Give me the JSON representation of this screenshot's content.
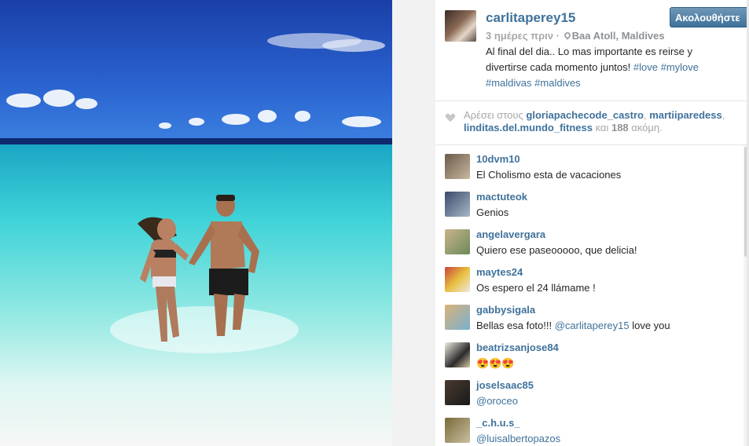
{
  "post": {
    "username": "carlitaperey15",
    "follow_label": "Ακολουθήστε",
    "time": "3 ημέρες πριν",
    "separator": "·",
    "location": "Baa Atoll, Maldives",
    "caption_text": "Al final del dia.. Lo mas importante es reirse y divertirse cada momento juntos!",
    "hashtags": [
      "#love",
      "#mylove",
      "#maldivas",
      "#maldives"
    ]
  },
  "likes": {
    "prefix": "Αρέσει στους",
    "users": [
      "gloriapachecode_castro",
      "martiiparedess",
      "linditas.del.mundo_fitness"
    ],
    "sep1": ",",
    "connector": "και",
    "count": "188",
    "suffix": "ακόμη."
  },
  "comments": [
    {
      "user": "10dvm10",
      "text": "El Cholismo esta de vacaciones",
      "avatar_color": "#6b5a4a"
    },
    {
      "user": "mactuteok",
      "text": "Genios",
      "avatar_color": "#3b4a6b"
    },
    {
      "user": "angelavergara",
      "text": "Quiero ese paseooooo, que delicia!",
      "avatar_color": "#c9b48a"
    },
    {
      "user": "maytes24",
      "text": "Os espero el 24 llámame !",
      "avatar_color": "#c8443a"
    },
    {
      "user": "gabbysigala",
      "text_before": "Bellas esa foto!!! ",
      "mention": "@carlitaperey15",
      "text_after": " love you",
      "avatar_color": "#d9b27a"
    },
    {
      "user": "beatrizsanjose84",
      "text": "😍😍😍",
      "avatar_color": "#2b2b2b"
    },
    {
      "user": "joselsaac85",
      "mention": "@oroceo",
      "avatar_color": "#4a3a30"
    },
    {
      "user": "_c.h.u.s_",
      "mention": "@luisalbertopazos",
      "avatar_color": "#7a6a3a"
    }
  ],
  "colors": {
    "link": "#3f729b",
    "muted": "#a5a7aa",
    "text": "#262626",
    "sky": "#1f4fb8",
    "sea": "#3fd0d8",
    "sand": "#f4f6f5"
  }
}
